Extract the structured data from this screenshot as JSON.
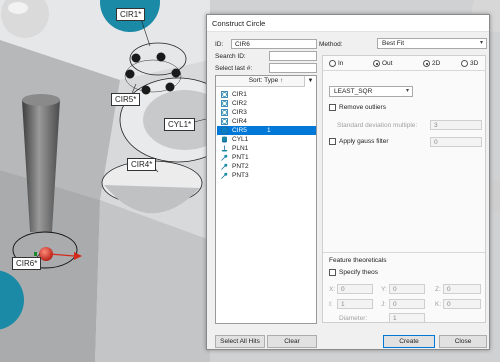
{
  "viewport": {
    "labels": {
      "cir1": "CIR1*",
      "cir5": "CIR5*",
      "cyl1": "CYL1*",
      "cir4": "CIR4*",
      "cir6": "CIR6*"
    }
  },
  "dialog": {
    "title": "Construct Circle",
    "id_label": "ID:",
    "id_value": "CIR6",
    "search_label": "Search ID:",
    "search_value": "",
    "select_last_label": "Select last #:",
    "select_last_value": "",
    "sort_label": "Sort: Type ↑",
    "features": [
      {
        "label": "CIR1",
        "icon": "circle-feature-icon",
        "count": ""
      },
      {
        "label": "CIR2",
        "icon": "circle-feature-icon",
        "count": ""
      },
      {
        "label": "CIR3",
        "icon": "circle-feature-icon",
        "count": ""
      },
      {
        "label": "CIR4",
        "icon": "circle-feature-icon",
        "count": ""
      },
      {
        "label": "CIR5",
        "icon": "circle-feature-icon",
        "count": "1",
        "selected": true
      },
      {
        "label": "CYL1",
        "icon": "cylinder-feature-icon",
        "count": ""
      },
      {
        "label": "PLN1",
        "icon": "plane-feature-icon",
        "count": ""
      },
      {
        "label": "PNT1",
        "icon": "point-feature-icon",
        "count": ""
      },
      {
        "label": "PNT2",
        "icon": "point-feature-icon",
        "count": ""
      },
      {
        "label": "PNT3",
        "icon": "point-feature-icon",
        "count": ""
      }
    ],
    "method_label": "Method:",
    "method_value": "Best Fit",
    "radio_in": "In",
    "radio_out": "Out",
    "radio_2d": "2D",
    "radio_3d": "3D",
    "selected_side": "Out",
    "selected_dim": "2D",
    "algorithm_value": "LEAST_SQR",
    "remove_outliers_label": "Remove outliers",
    "std_dev_label": "Standard deviation multiple:",
    "std_dev_value": "3",
    "gauss_label": "Apply gauss filter",
    "gauss_value": "0",
    "feature_theo_label": "Feature theoreticals",
    "specify_theos_label": "Specify theos",
    "x_label": "X:",
    "x_value": "0",
    "y_label": "Y:",
    "y_value": "0",
    "z_label": "Z:",
    "z_value": "0",
    "i_label": "I:",
    "i_value": "1",
    "j_label": "J:",
    "j_value": "0",
    "k_label": "K:",
    "k_value": "0",
    "diameter_label": "Diameter:",
    "diameter_value": "1",
    "select_all_label": "Select All Hits",
    "clear_label": "Clear",
    "create_label": "Create",
    "close_label": "Close"
  },
  "colors": {
    "accent": "#0078d7",
    "probe_red": "#d42a1c",
    "teal": "#1a8aa6"
  }
}
